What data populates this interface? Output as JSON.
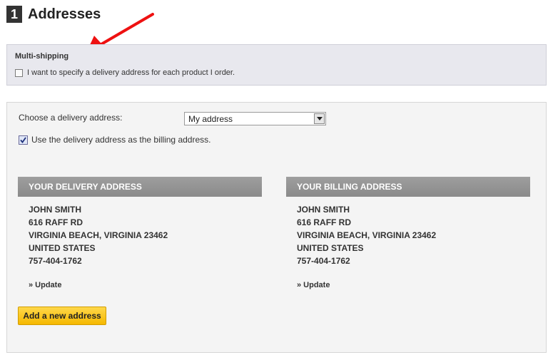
{
  "step": {
    "number": "1",
    "title": "Addresses"
  },
  "multi_shipping": {
    "title": "Multi-shipping",
    "checkbox_label": "I want to specify a delivery address for each product I order.",
    "checked": false
  },
  "address_choice": {
    "label": "Choose a delivery address:",
    "selected": "My address",
    "use_as_billing_label": "Use the delivery address as the billing address.",
    "use_as_billing_checked": true
  },
  "delivery": {
    "heading": "YOUR DELIVERY ADDRESS",
    "lines": [
      "JOHN SMITH",
      "616 RAFF RD",
      "VIRGINIA BEACH, VIRGINIA 23462",
      "UNITED STATES",
      "757-404-1762"
    ],
    "update_label": "» Update"
  },
  "billing": {
    "heading": "YOUR BILLING ADDRESS",
    "lines": [
      "JOHN SMITH",
      "616 RAFF RD",
      "VIRGINIA BEACH, VIRGINIA 23462",
      "UNITED STATES",
      "757-404-1762"
    ],
    "update_label": "» Update"
  },
  "add_address_label": "Add a new address",
  "colors": {
    "accent_button": "#f5b800",
    "section_header": "#8a8a8a",
    "annotation_arrow": "#ee1111"
  },
  "icons": {
    "annotation": "red-arrow-icon",
    "select": "chevron-down-icon",
    "checked": "checkmark-icon"
  }
}
